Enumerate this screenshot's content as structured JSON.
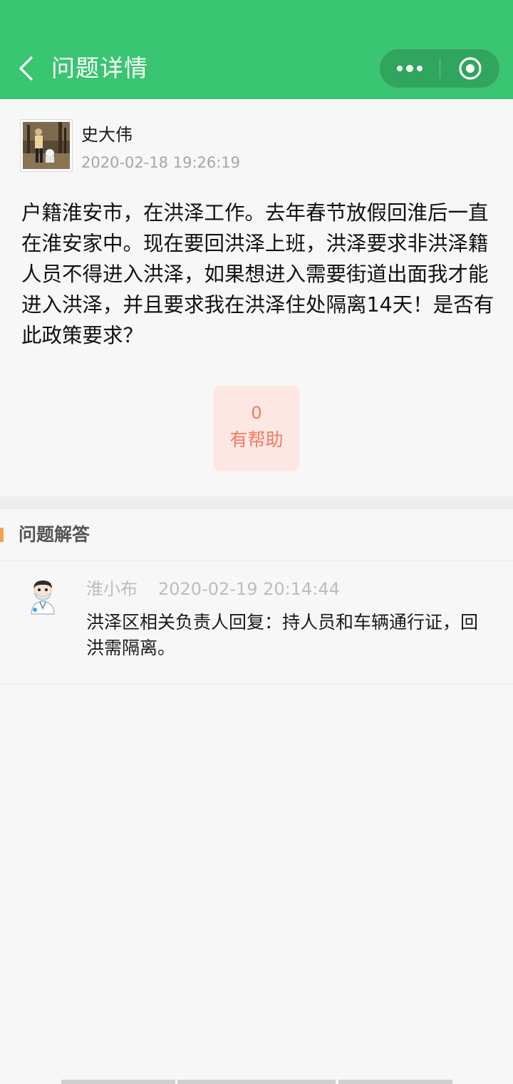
{
  "header": {
    "title": "问题详情",
    "back_icon": "chevron-left-icon",
    "more_icon": "more-dots-icon",
    "close_icon": "target-circle-icon",
    "bg_color": "#39c571"
  },
  "question": {
    "author": "史大伟",
    "time": "2020-02-18 19:26:19",
    "content": "户籍淮安市，在洪泽工作。去年春节放假回淮后一直在淮安家中。现在要回洪泽上班，洪泽要求非洪泽籍人员不得进入洪泽，如果想进入需要街道出面我才能进入洪泽，并且要求我在洪泽住处隔离14天！是否有此政策要求？",
    "helpful_count": "0",
    "helpful_label": "有帮助",
    "helpful_color": "#f17b5f"
  },
  "answers": {
    "section_title": "问题解答",
    "accent_color": "#f5a04a",
    "items": [
      {
        "author": "淮小布",
        "time": "2020-02-19 20:14:44",
        "content": "洪泽区相关负责人回复：持人员和车辆通行证，回洪需隔离。"
      }
    ]
  }
}
